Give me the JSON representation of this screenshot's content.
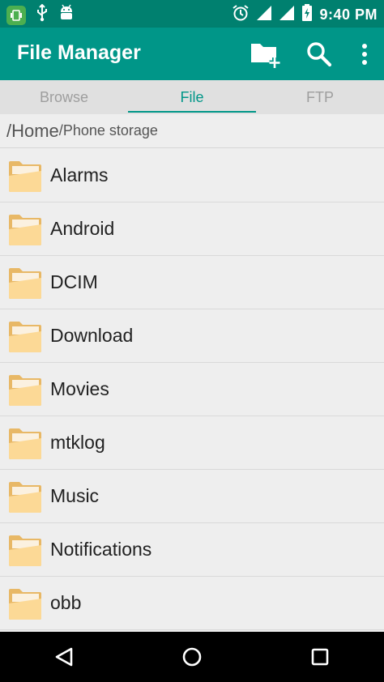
{
  "status_bar": {
    "time": "9:40",
    "ampm": "PM",
    "left_icons": [
      "screen-mirror-icon",
      "usb-icon",
      "android-debug-icon"
    ],
    "right_icons": [
      "alarm-icon",
      "signal-icon",
      "signal-icon",
      "battery-charging-icon"
    ]
  },
  "appbar": {
    "title": "File Manager",
    "actions": [
      "new-folder-icon",
      "search-icon",
      "more-vert-icon"
    ]
  },
  "tabs": [
    {
      "label": "Browse",
      "active": false
    },
    {
      "label": "File",
      "active": true
    },
    {
      "label": "FTP",
      "active": false
    }
  ],
  "breadcrumb": {
    "home": "/Home",
    "separator": "/",
    "current": "Phone storage"
  },
  "files": [
    {
      "name": "Alarms"
    },
    {
      "name": "Android"
    },
    {
      "name": "DCIM"
    },
    {
      "name": "Download"
    },
    {
      "name": "Movies"
    },
    {
      "name": "mtklog"
    },
    {
      "name": "Music"
    },
    {
      "name": "Notifications"
    },
    {
      "name": "obb"
    }
  ],
  "colors": {
    "status_bar": "#00806f",
    "app_bar": "#009688",
    "accent": "#009688",
    "folder_back": "#e8b866",
    "folder_front": "#fcd996"
  }
}
